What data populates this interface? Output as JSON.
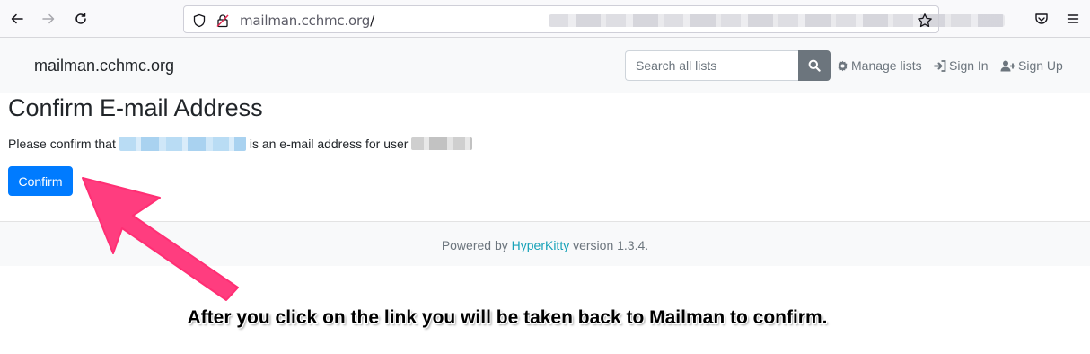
{
  "browser": {
    "url_domain": "mailman.cchmc.org",
    "url_suffix": "/",
    "icons": [
      "back-arrow-icon",
      "forward-arrow-icon",
      "reload-icon",
      "shield-icon",
      "lock-icon",
      "star-icon",
      "pocket-icon",
      "menu-icon"
    ]
  },
  "header": {
    "brand": "mailman.cchmc.org",
    "search_placeholder": "Search all lists",
    "manage_lists": "Manage lists",
    "sign_in": "Sign In",
    "sign_up": "Sign Up"
  },
  "main": {
    "title": "Confirm E-mail Address",
    "text_before": "Please confirm that",
    "text_middle": "is an e-mail address for user",
    "confirm_button": "Confirm"
  },
  "footer": {
    "powered_by": "Powered by",
    "hyperkitty": "HyperKitty",
    "version": "version 1.3.4."
  },
  "annotation": {
    "text": "After you click on the link you will be taken back to Mailman to confirm.",
    "arrow_color": "#ff3d7f"
  },
  "colors": {
    "primary": "#007bff",
    "secondary": "#6c757d",
    "link": "#17a2b8"
  }
}
